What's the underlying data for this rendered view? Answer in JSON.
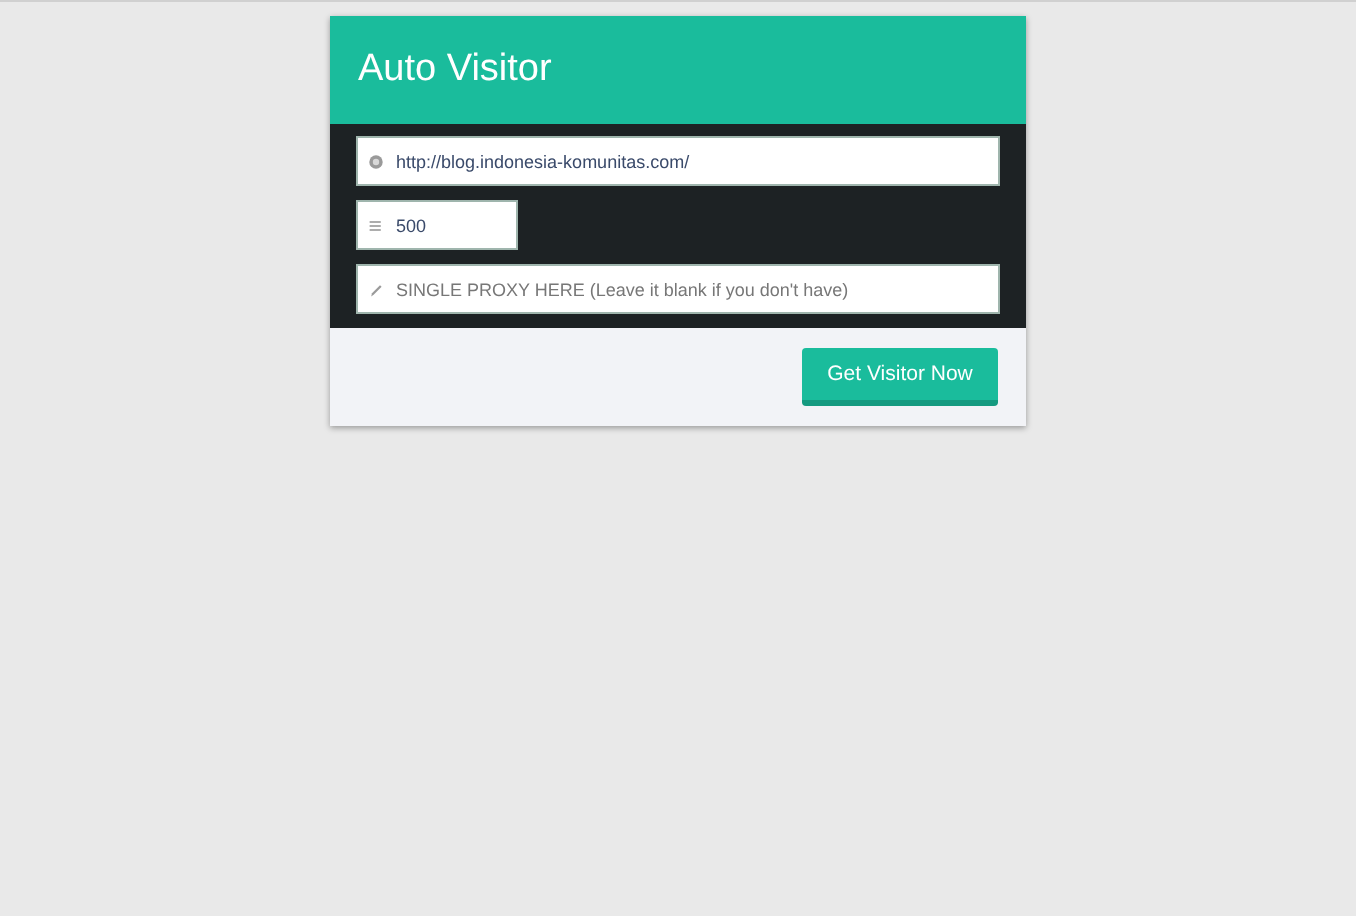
{
  "card": {
    "title": "Auto Visitor"
  },
  "fields": [
    {
      "kind": "url",
      "value": "http://blog.indonesia-komunitas.com/"
    },
    {
      "kind": "count",
      "value": "500"
    },
    {
      "kind": "proxy",
      "placeholder": "SINGLE PROXY HERE (Leave it blank if you don't have)"
    }
  ],
  "submit_button": "Get Visitor Now"
}
